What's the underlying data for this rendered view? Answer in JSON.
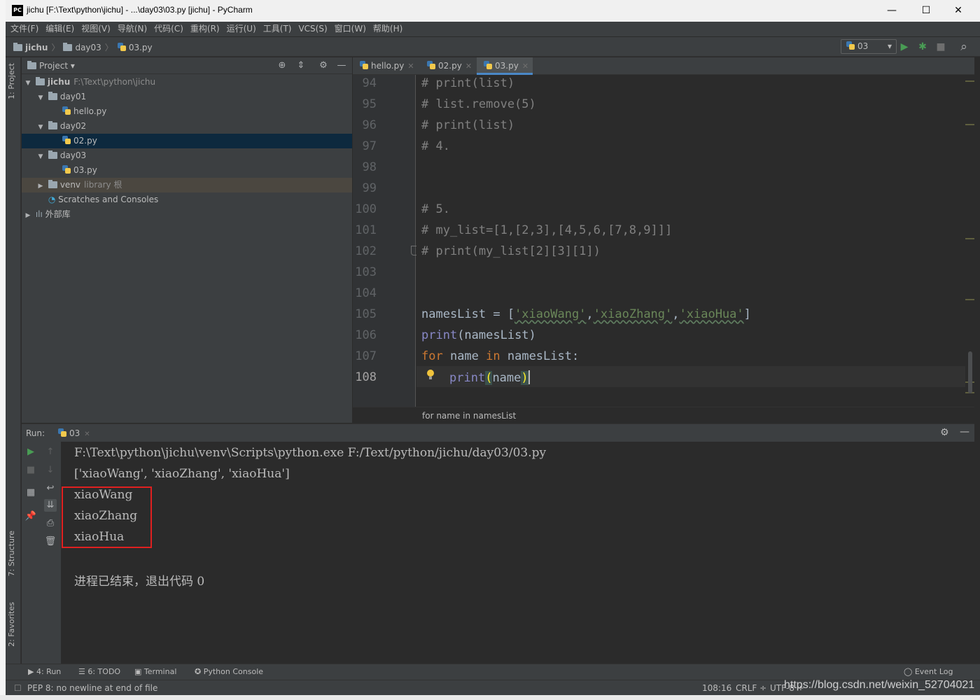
{
  "window": {
    "title": "jichu [F:\\Text\\python\\jichu] - ...\\day03\\03.py [jichu] - PyCharm",
    "app_icon_text": "PC",
    "minimize": "—",
    "maximize": "☐",
    "close": "✕"
  },
  "menu": [
    "文件(F)",
    "编辑(E)",
    "视图(V)",
    "导航(N)",
    "代码(C)",
    "重构(R)",
    "运行(U)",
    "工具(T)",
    "VCS(S)",
    "窗口(W)",
    "帮助(H)"
  ],
  "breadcrumb": {
    "project": "jichu",
    "folder": "day03",
    "file": "03.py"
  },
  "run_config": {
    "name": "03",
    "dropdown_icon": "▾",
    "run_icon": "▶",
    "debug_icon": "✱",
    "stop_icon": "■",
    "search_icon": "⌕"
  },
  "left_strip": {
    "project_tab": "1: Project",
    "structure_tab": "7: Structure",
    "favorites_tab": "2: Favorites"
  },
  "project_panel": {
    "header": "Project ▾",
    "icons": {
      "locate": "⊕",
      "collapse": "⇕",
      "settings": "⚙",
      "hide": "—"
    },
    "tree": [
      {
        "label": "jichu",
        "hint": "F:\\Text\\python\\jichu",
        "type": "folder",
        "expanded": true
      },
      {
        "label": "day01",
        "type": "folder",
        "expanded": true
      },
      {
        "label": "hello.py",
        "type": "py"
      },
      {
        "label": "day02",
        "type": "folder",
        "expanded": true
      },
      {
        "label": "02.py",
        "type": "py",
        "selected": true
      },
      {
        "label": "day03",
        "type": "folder",
        "expanded": true
      },
      {
        "label": "03.py",
        "type": "py"
      },
      {
        "label": "venv",
        "hint": "library 根",
        "type": "folder",
        "expanded": false
      },
      {
        "label": "Scratches and Consoles",
        "type": "scratch"
      },
      {
        "label": "外部库",
        "type": "lib",
        "expanded": false
      }
    ]
  },
  "editor": {
    "tabs": [
      {
        "label": "hello.py",
        "close": "✕"
      },
      {
        "label": "02.py",
        "close": "✕"
      },
      {
        "label": "03.py",
        "close": "✕",
        "active": true
      }
    ],
    "line_numbers": [
      "94",
      "95",
      "96",
      "97",
      "98",
      "99",
      "100",
      "101",
      "102",
      "103",
      "104",
      "105",
      "106",
      "107",
      "108"
    ],
    "code": {
      "l94": "# print(list)",
      "l95": "# list.remove(5)",
      "l96": "# print(list)",
      "l97": "# 4.",
      "l100": "# 5.",
      "l101": "# my_list=[1,[2,3],[4,5,6,[7,8,9]]]",
      "l102": "# print(my_list[2][3][1])",
      "l105_a": "namesList = [",
      "l105_s1": "'xiaoWang'",
      "l105_c": ",",
      "l105_s2": "'xiaoZhang'",
      "l105_s3": "'xiaoHua'",
      "l105_b": "]",
      "l106_fn": "print",
      "l106_rest": "(namesList)",
      "l107_for": "for",
      "l107_mid": " name ",
      "l107_in": "in",
      "l107_rest": " namesList:",
      "l108_fn": "print",
      "l108_open": "(",
      "l108_arg": "name",
      "l108_close": ")"
    },
    "breadcrumb": "for name in namesList"
  },
  "run_panel": {
    "label": "Run:",
    "tab": "03",
    "tab_close": "✕",
    "settings_icon": "⚙",
    "hide_icon": "—",
    "output": [
      "F:\\Text\\python\\jichu\\venv\\Scripts\\python.exe F:/Text/python/jichu/day03/03.py",
      "['xiaoWang', 'xiaoZhang', 'xiaoHua']",
      "xiaoWang",
      "xiaoZhang",
      "xiaoHua",
      "",
      "进程已结束，退出代码 0"
    ]
  },
  "bottom_tools": {
    "run": "4: Run",
    "todo": "6: TODO",
    "terminal": "Terminal",
    "python_console": "Python Console",
    "event_log": "Event Log"
  },
  "status": {
    "message": "PEP 8: no newline at end of file",
    "position": "108:16",
    "line_sep": "CRLF ÷",
    "encoding": "UTF-8 ÷"
  },
  "watermark": "https://blog.csdn.net/weixin_52704021"
}
